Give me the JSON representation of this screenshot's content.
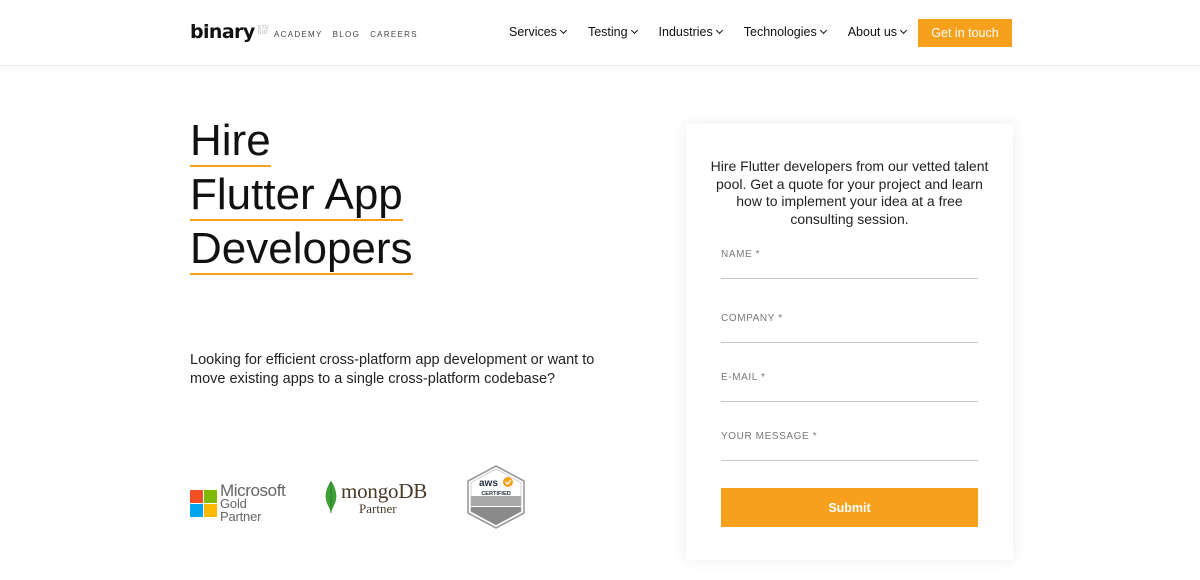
{
  "header": {
    "logo_text": "binary",
    "logo_sub": [
      "STU",
      "DIO"
    ],
    "small_links": [
      "ACADEMY",
      "BLOG",
      "CAREERS"
    ],
    "nav": [
      "Services",
      "Testing",
      "Industries",
      "Technologies",
      "About us"
    ],
    "cta_label": "Get in touch"
  },
  "hero": {
    "title_lines": [
      "Hire",
      "Flutter App",
      "Developers"
    ],
    "intro": "Looking for efficient cross-platform app development or want to move existing apps to a single cross-platform codebase?"
  },
  "partners": {
    "microsoft": {
      "line1": "Microsoft",
      "line2": "Gold Partner",
      "colors": [
        "#f25022",
        "#7fba00",
        "#00a4ef",
        "#ffb900"
      ]
    },
    "mongodb": {
      "line1": "mongoDB",
      "line2": "Partner"
    },
    "aws": {
      "line1": "aws",
      "line2": "CERTIFIED"
    }
  },
  "form": {
    "intro": "Hire Flutter developers from our vetted talent pool. Get a quote for your project and learn how to implement your idea at a free consulting session.",
    "fields": [
      "NAME *",
      "COMPANY *",
      "E-MAIL *",
      "YOUR MESSAGE *"
    ],
    "submit_label": "Submit"
  },
  "colors": {
    "accent": "#f7a01b"
  }
}
